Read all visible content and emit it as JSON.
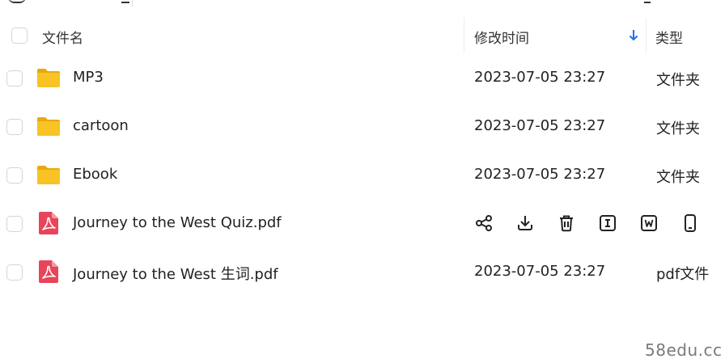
{
  "header": {
    "name_label": "文件名",
    "time_label": "修改时间",
    "type_label": "类型"
  },
  "files": [
    {
      "name": "MP3",
      "modified": "2023-07-05 23:27",
      "type": "文件夹",
      "icon": "folder-icon"
    },
    {
      "name": "cartoon",
      "modified": "2023-07-05 23:27",
      "type": "文件夹",
      "icon": "folder-icon"
    },
    {
      "name": "Ebook",
      "modified": "2023-07-05 23:27",
      "type": "文件夹",
      "icon": "folder-icon"
    },
    {
      "name": "Journey to the West Quiz.pdf",
      "icon": "pdf-file-icon",
      "hovered": true,
      "actions": [
        "share-icon",
        "download-icon",
        "delete-icon",
        "text-extract-icon",
        "word-convert-icon",
        "phone-send-icon"
      ]
    },
    {
      "name": "Journey to the West 生词.pdf",
      "modified": "2023-07-05 23:27",
      "type": "pdf文件",
      "icon": "pdf-file-icon"
    }
  ],
  "watermark": "58edu.cc",
  "colors": {
    "folder": "#f7c325",
    "pdf": "#e8455a",
    "sort_arrow": "#1a73e8",
    "checkbox_border": "#d4d4d4"
  }
}
